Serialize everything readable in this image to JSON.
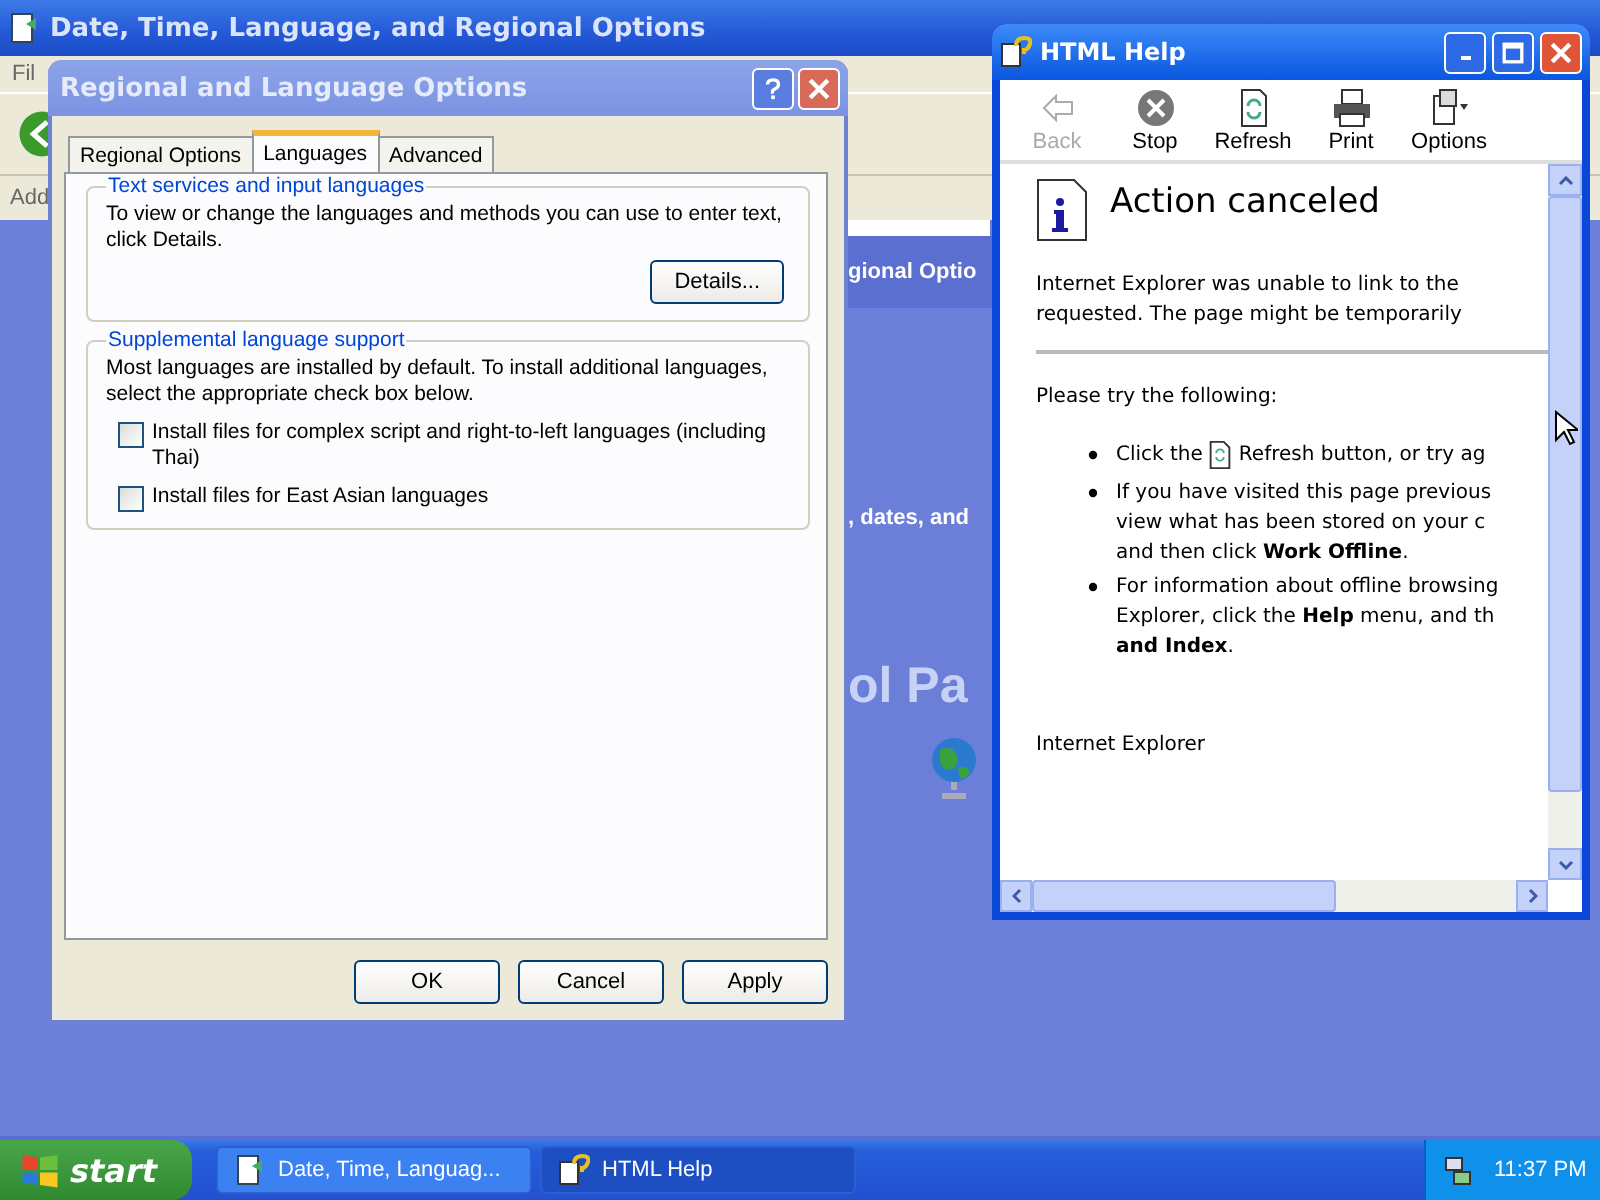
{
  "background_window": {
    "title": "Date, Time, Language, and Regional Options",
    "menu": [
      "Fil"
    ],
    "address_label": "Add",
    "panel_heading": "gional Optio",
    "panel_text": ", dates, and",
    "panel_title": "ol Pa"
  },
  "dialog": {
    "title": "Regional and Language Options",
    "tabs": [
      {
        "label": "Regional Options",
        "selected": false
      },
      {
        "label": "Languages",
        "selected": true
      },
      {
        "label": "Advanced",
        "selected": false
      }
    ],
    "groups": [
      {
        "legend": "Text services and input languages",
        "text": "To view or change the languages and methods you can use to enter text, click Details.",
        "button": "Details..."
      },
      {
        "legend": "Supplemental language support",
        "text": "Most languages are installed by default. To install additional languages, select the appropriate check box below.",
        "checkboxes": [
          {
            "label": "Install files for complex script and right-to-left languages (including Thai)",
            "checked": false
          },
          {
            "label": "Install files for East Asian languages",
            "checked": false
          }
        ]
      }
    ],
    "buttons": [
      "OK",
      "Cancel",
      "Apply"
    ]
  },
  "help_window": {
    "title": "HTML Help",
    "toolbar": [
      {
        "label": "Back",
        "kind": "back",
        "disabled": true
      },
      {
        "label": "Stop",
        "kind": "stop",
        "disabled": false
      },
      {
        "label": "Refresh",
        "kind": "refresh",
        "disabled": false
      },
      {
        "label": "Print",
        "kind": "print",
        "disabled": false
      },
      {
        "label": "Options",
        "kind": "options",
        "disabled": false
      }
    ],
    "heading": "Action canceled",
    "intro_lines": [
      "Internet Explorer was unable to link to the",
      "requested. The page might be temporarily"
    ],
    "try_heading": "Please try the following:",
    "bullets": [
      {
        "kind": "refresh",
        "before": "Click the",
        "after": "Refresh button, or try ag"
      },
      {
        "kind": "text",
        "lines": [
          "If you have visited this page previous",
          "view what has been stored on your c",
          "and then click **Work Offline**."
        ]
      },
      {
        "kind": "text",
        "lines": [
          "For information about offline browsing",
          "Explorer, click the **Help** menu, and th",
          "**and Index**."
        ]
      }
    ],
    "footer": "Internet Explorer"
  },
  "taskbar": {
    "start": "start",
    "tasks": [
      {
        "label": "Date, Time, Languag...",
        "kind": "folder",
        "selected": false
      },
      {
        "label": "HTML Help",
        "kind": "help",
        "selected": true
      }
    ],
    "clock": "11:37 PM"
  }
}
